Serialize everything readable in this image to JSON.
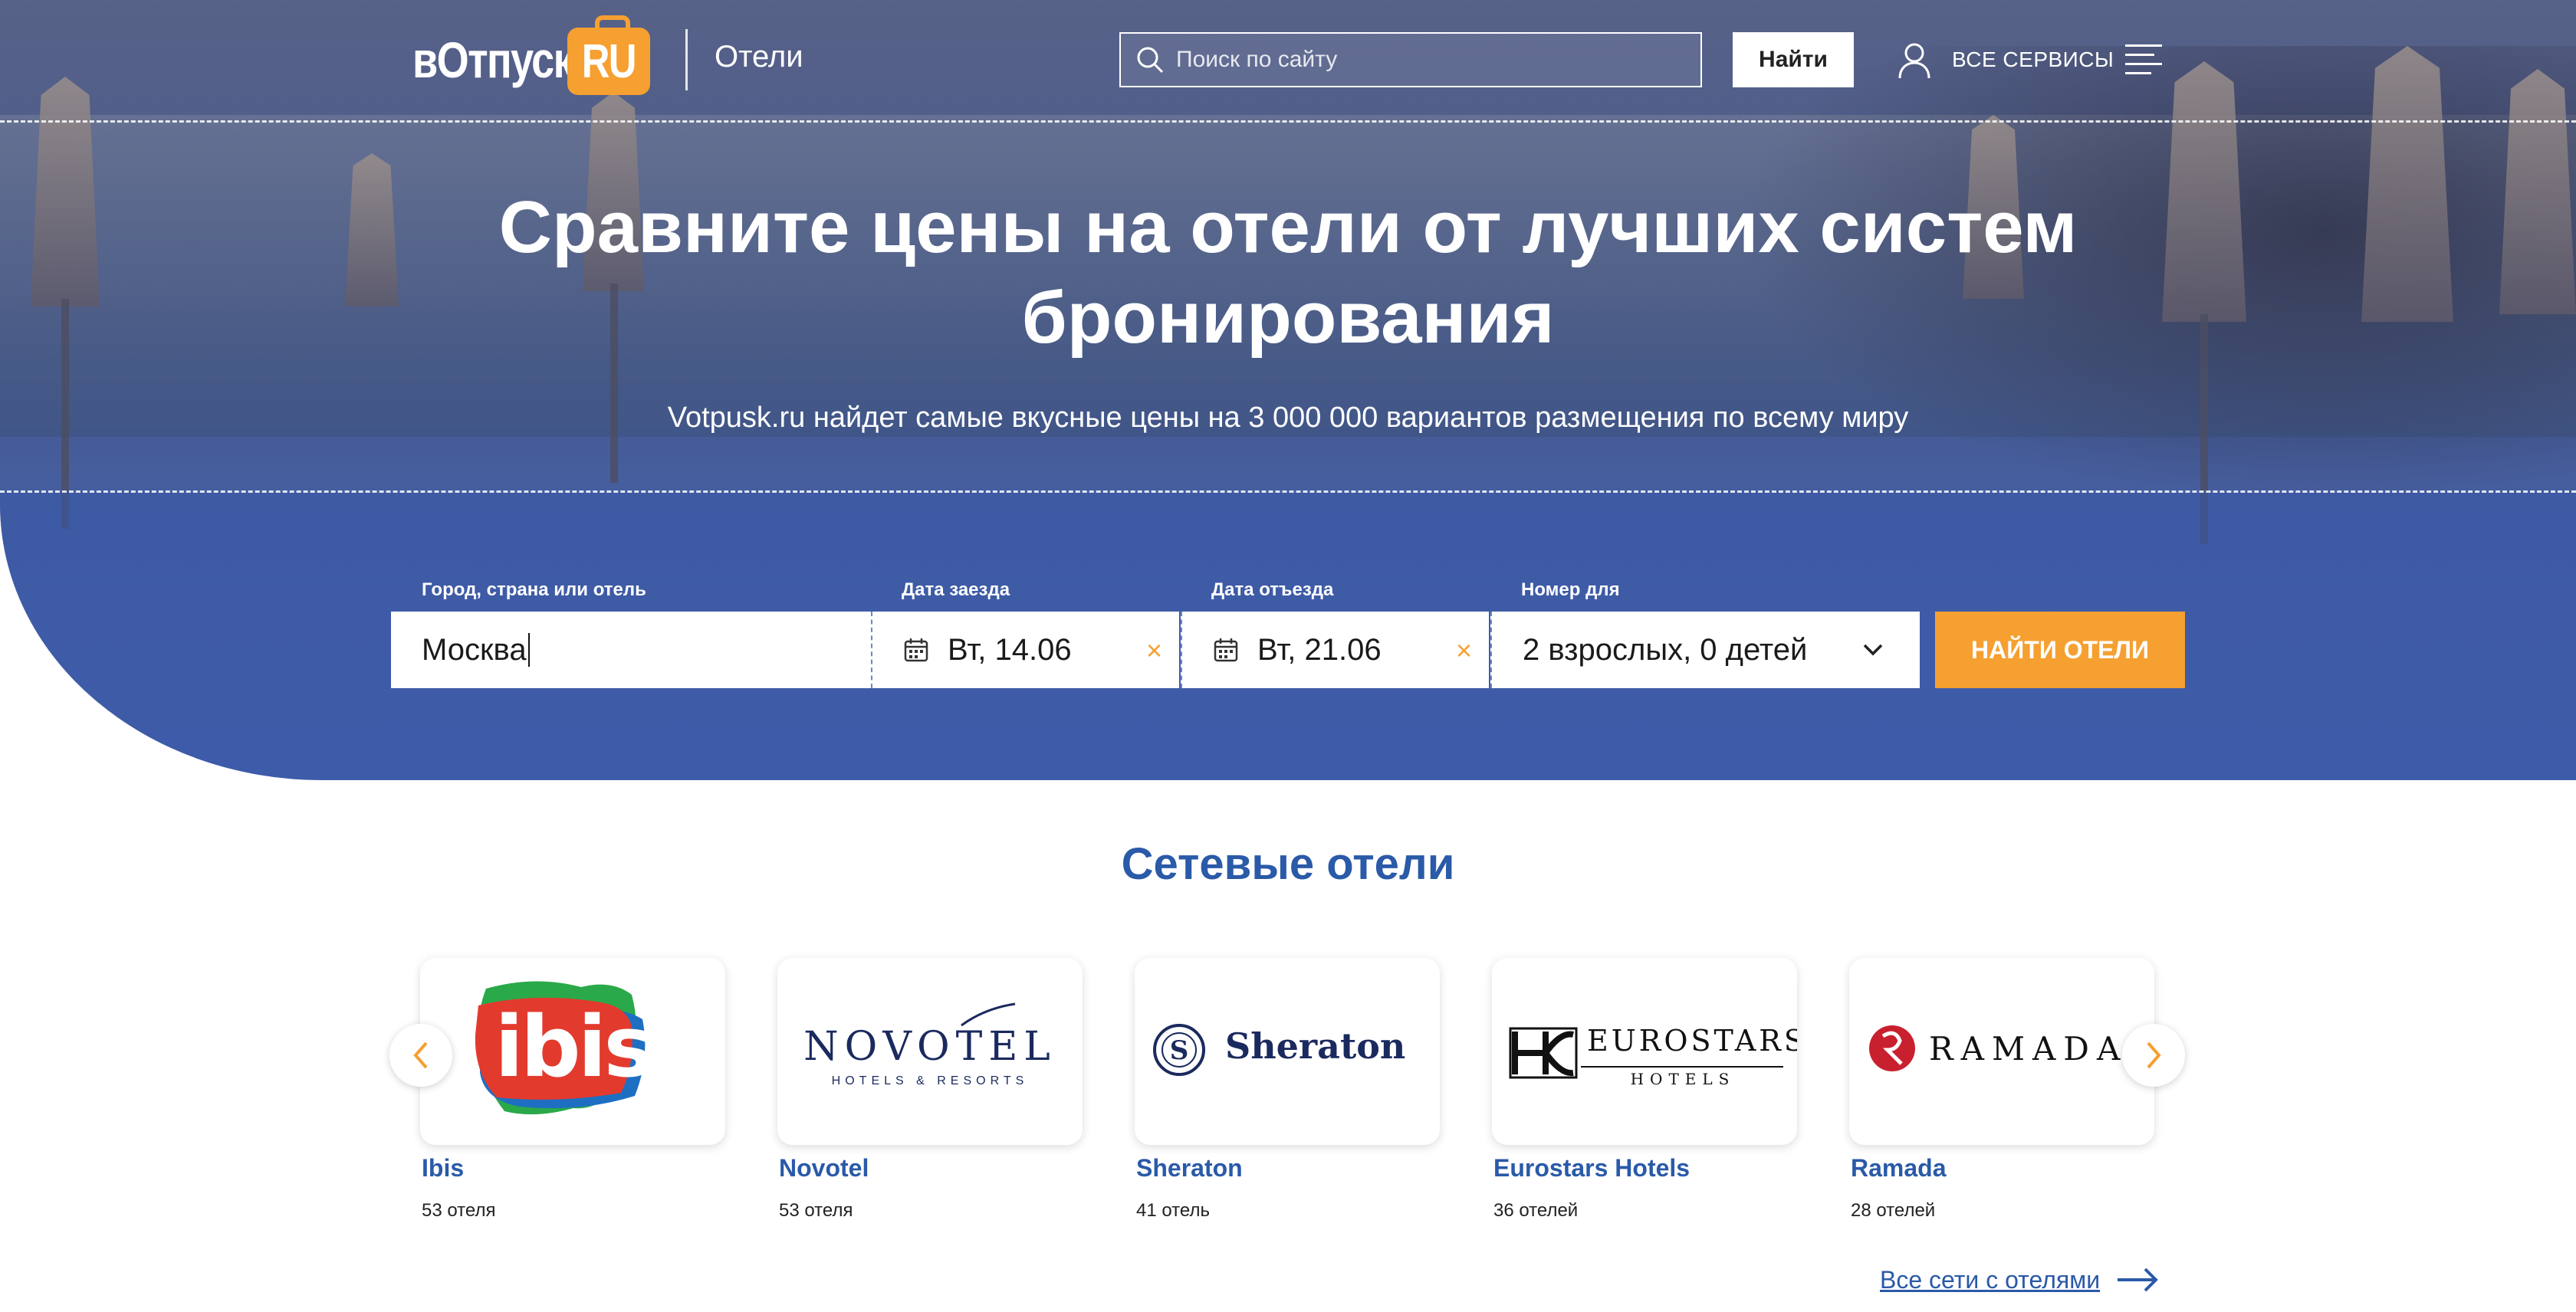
{
  "header": {
    "logo_main": "вОтпуск",
    "logo_badge": "RU",
    "section": "Отели",
    "search_placeholder": "Поиск по сайту",
    "search_button": "Найти",
    "services_label": "ВСЕ СЕРВИСЫ"
  },
  "hero": {
    "title_line1": "Сравните цены на отели от лучших систем",
    "title_line2": "бронирования",
    "subtitle": "Votpusk.ru найдет самые вкусные цены на 3 000 000 вариантов размещения по всему миру"
  },
  "search_form": {
    "city_label": "Город, страна или отель",
    "city_value": "Москва",
    "checkin_label": "Дата заезда",
    "checkin_value": "Вт, 14.06",
    "checkout_label": "Дата отъезда",
    "checkout_value": "Вт, 21.06",
    "guests_label": "Номер для",
    "guests_value": "2 взрослых, 0 детей",
    "clear_symbol": "×",
    "submit_label": "НАЙТИ ОТЕЛИ"
  },
  "chains": {
    "title": "Сетевые отели",
    "items": [
      {
        "name": "Ibis",
        "count": "53 отеля",
        "logo_text": "ibis"
      },
      {
        "name": "Novotel",
        "count": "53 отеля",
        "logo_text": "NOVOTEL",
        "logo_sub": "HOTELS & RESORTS"
      },
      {
        "name": "Sheraton",
        "count": "41 отель",
        "logo_text": "Sheraton"
      },
      {
        "name": "Eurostars Hotels",
        "count": "36 отелей",
        "logo_text": "EUROSTARS",
        "logo_sub": "HOTELS"
      },
      {
        "name": "Ramada",
        "count": "28 отелей",
        "logo_text": "RAMADA"
      }
    ],
    "all_link": "Все сети с отелями"
  },
  "colors": {
    "accent_orange": "#f5a031",
    "brand_blue": "#2a5aa8"
  }
}
